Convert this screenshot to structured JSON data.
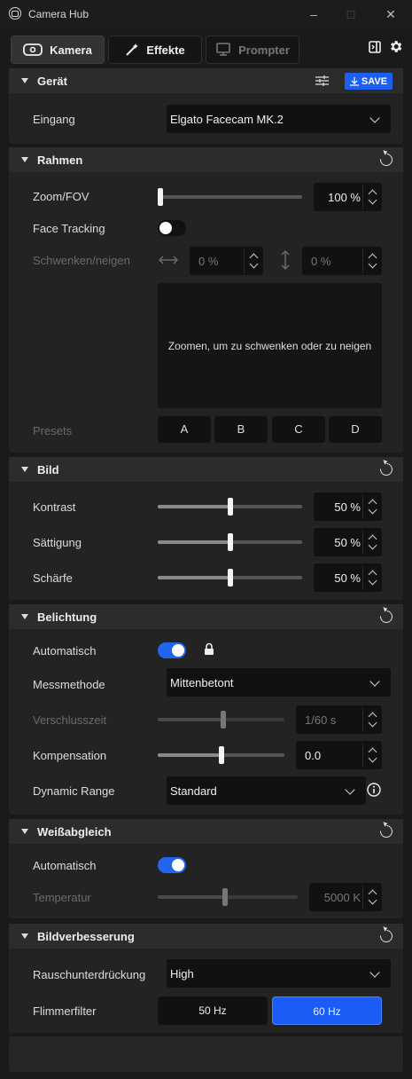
{
  "window": {
    "title": "Camera Hub"
  },
  "tabs": [
    {
      "label": "Kamera"
    },
    {
      "label": "Effekte"
    },
    {
      "label": "Prompter"
    }
  ],
  "colors": {
    "accent": "#1d5ff0",
    "panel": "#232323",
    "header": "#2c2c2c"
  },
  "geraet": {
    "title": "Gerät",
    "save_label": "SAVE",
    "input_label": "Eingang",
    "input_value": "Elgato Facecam MK.2"
  },
  "rahmen": {
    "title": "Rahmen",
    "zoom_label": "Zoom/FOV",
    "zoom_value": "100 %",
    "zoom_level": 0,
    "face_tracking_label": "Face Tracking",
    "face_tracking_on": false,
    "pan_tilt_label": "Schwenken/neigen",
    "pan_value": "0 %",
    "tilt_value": "0 %",
    "preview_text": "Zoomen, um zu schwenken oder zu neigen",
    "presets_label": "Presets",
    "presets": [
      "A",
      "B",
      "C",
      "D"
    ]
  },
  "bild": {
    "title": "Bild",
    "kontrast_label": "Kontrast",
    "kontrast_value": "50 %",
    "saettigung_label": "Sättigung",
    "saettigung_value": "50 %",
    "schaerfe_label": "Schärfe",
    "schaerfe_value": "50 %",
    "level": 0.5
  },
  "belichtung": {
    "title": "Belichtung",
    "auto_label": "Automatisch",
    "auto_on": true,
    "mess_label": "Messmethode",
    "mess_value": "Mittenbetont",
    "verschluss_label": "Verschlusszeit",
    "verschluss_value": "1/60 s",
    "komp_label": "Kompensation",
    "komp_value": "0.0",
    "dr_label": "Dynamic Range",
    "dr_value": "Standard"
  },
  "weiss": {
    "title": "Weißabgleich",
    "auto_label": "Automatisch",
    "auto_on": true,
    "temp_label": "Temperatur",
    "temp_value": "5000 K"
  },
  "verbesserung": {
    "title": "Bildverbesserung",
    "rausch_label": "Rauschunterdrückung",
    "rausch_value": "High",
    "flimmer_label": "Flimmerfilter",
    "flimmer_options": [
      "50 Hz",
      "60 Hz"
    ],
    "flimmer_selected": "60 Hz"
  }
}
